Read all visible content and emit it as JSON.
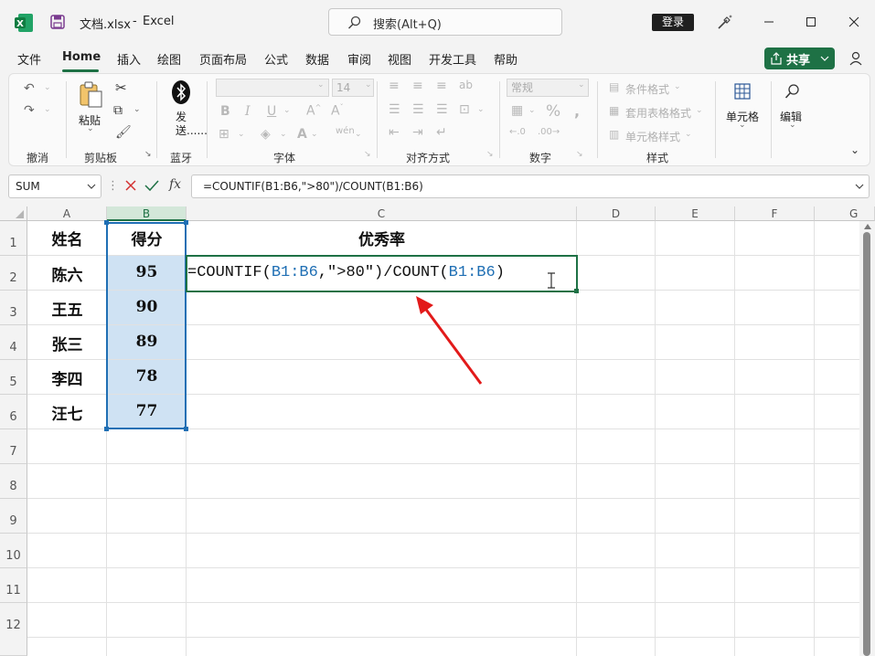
{
  "titlebar": {
    "filename": "文档.xlsx",
    "separator": "-",
    "app": "Excel",
    "search_placeholder": "搜索(Alt+Q)",
    "login": "登录"
  },
  "menu": [
    "文件",
    "Home",
    "插入",
    "绘图",
    "页面布局",
    "公式",
    "数据",
    "审阅",
    "视图",
    "开发工具",
    "帮助"
  ],
  "share_label": "共享",
  "ribbon": {
    "groups": {
      "undo": "撤消",
      "clipboard": "剪贴板",
      "bluetooth": "蓝牙",
      "font": "字体",
      "alignment": "对齐方式",
      "number": "数字",
      "styles": "样式"
    },
    "paste_label": "粘贴",
    "send_label": "发送......",
    "font_size": "14",
    "number_format": "常规",
    "conditional_format": "条件格式",
    "table_format": "套用表格格式",
    "cell_styles": "单元格样式",
    "cells_label": "单元格",
    "editing_label": "编辑"
  },
  "formula_bar": {
    "name_box": "SUM",
    "fx": "fx",
    "formula": "=COUNTIF(B1:B6,\">80\")/COUNT(B1:B6)"
  },
  "sheet": {
    "columns": [
      "A",
      "B",
      "C",
      "D",
      "E",
      "F",
      "G"
    ],
    "rows": [
      "1",
      "2",
      "3",
      "4",
      "5",
      "6",
      "7",
      "8",
      "9",
      "10",
      "11",
      "12"
    ],
    "header": {
      "a1": "姓名",
      "b1": "得分",
      "c1": "优秀率"
    },
    "names": [
      "陈六",
      "王五",
      "张三",
      "李四",
      "汪七"
    ],
    "scores": [
      "95",
      "90",
      "89",
      "78",
      "77"
    ],
    "edit": {
      "prefix": "=COUNTIF(",
      "ref1": "B1:B6",
      "middle": ",\">80\")/COUNT(",
      "ref2": "B1:B6",
      "suffix": ")"
    }
  },
  "colors": {
    "accent": "#1e7145",
    "reference": "#1f6fb4",
    "selection_fill": "#cfe2f3",
    "arrow": "#e21a1a"
  }
}
